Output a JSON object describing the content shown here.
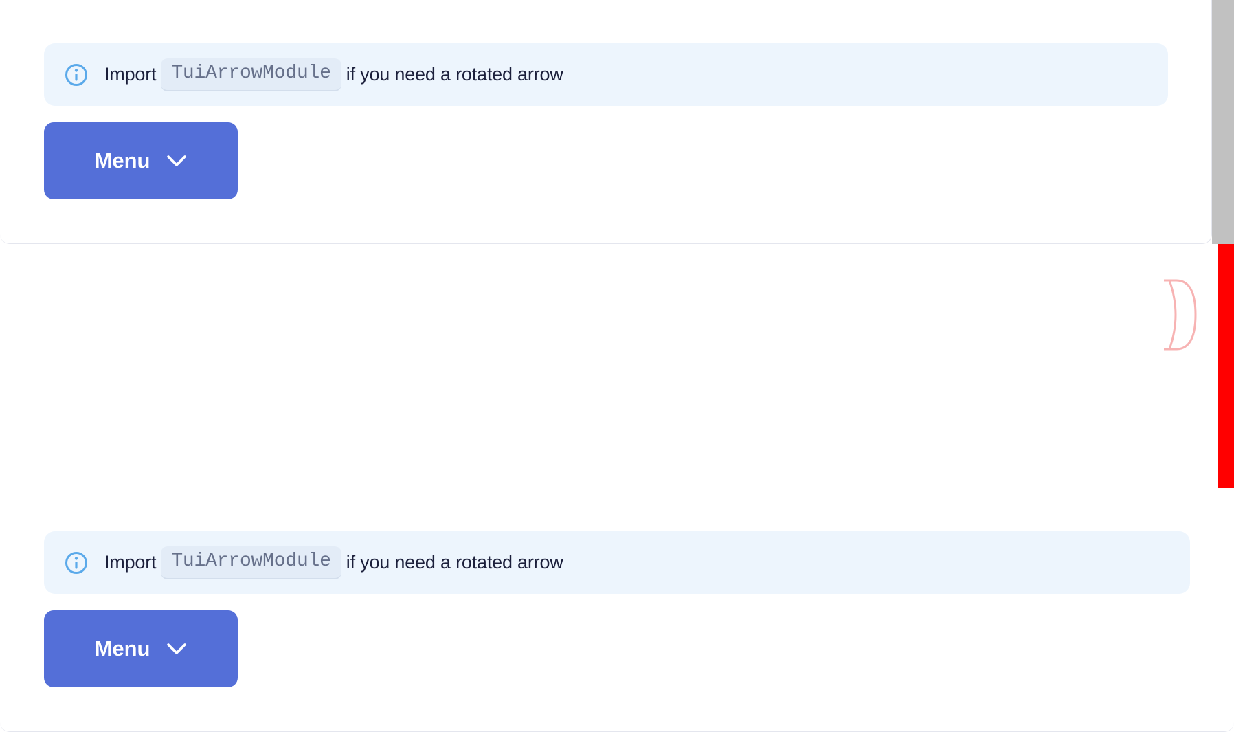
{
  "sections": [
    {
      "notice": {
        "prefix": "Import",
        "code": "TuiArrowModule",
        "suffix": "if you need a rotated arrow",
        "icon": "info-icon"
      },
      "button": {
        "label": "Menu",
        "icon": "chevron-down-icon"
      }
    },
    {
      "notice": {
        "prefix": "Import",
        "code": "TuiArrowModule",
        "suffix": "if you need a rotated arrow",
        "icon": "info-icon"
      },
      "button": {
        "label": "Menu",
        "icon": "chevron-down-icon"
      }
    }
  ],
  "colors": {
    "primary_button": "#546fd8",
    "notice_background": "#edf5fd",
    "info_icon": "#5aa9ea",
    "scrollbar_thumb": "#c1c1c1",
    "scrollbar_highlight": "#ff0000"
  }
}
